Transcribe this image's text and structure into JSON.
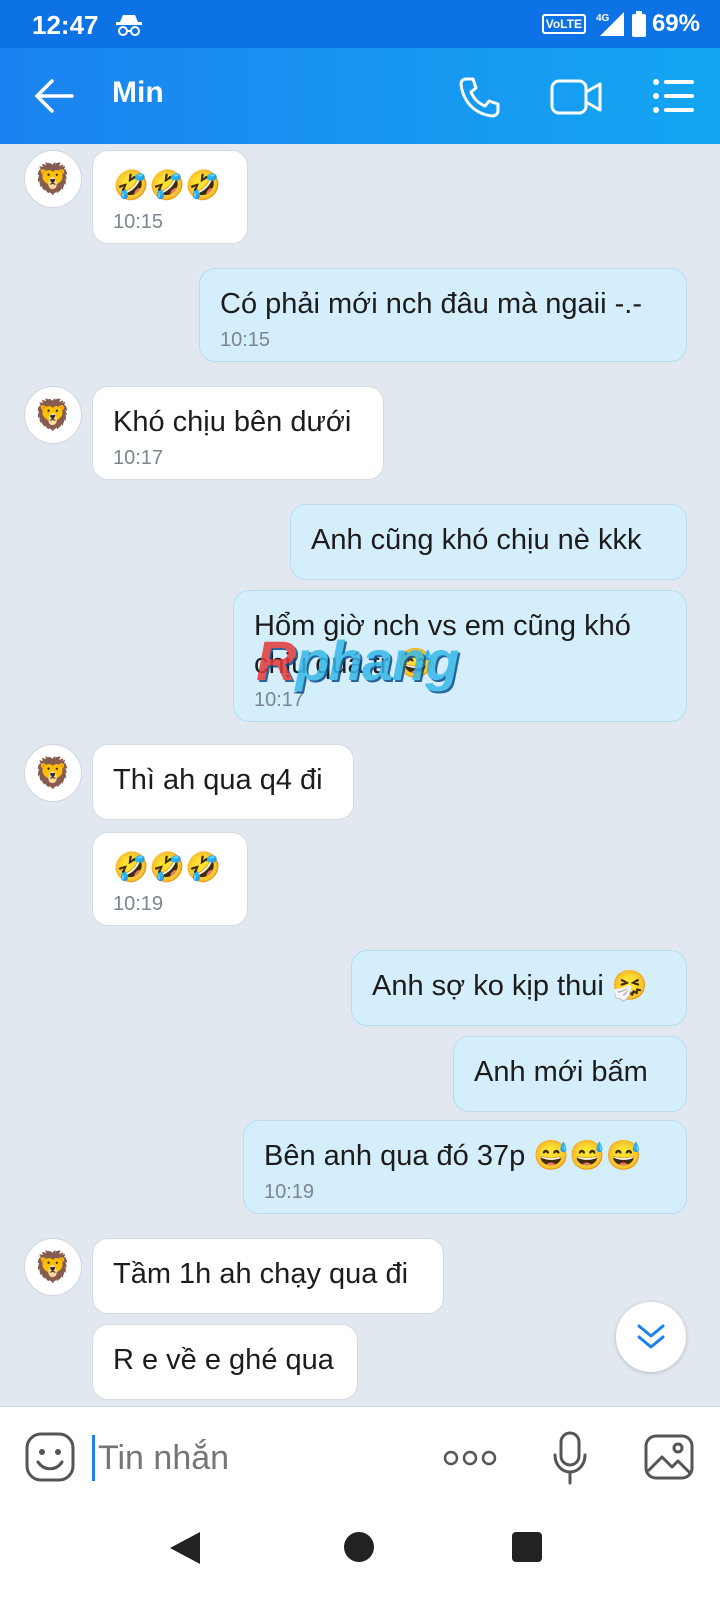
{
  "status": {
    "time": "12:47",
    "volte": "VoLTE",
    "network": "4G",
    "battery": "69%"
  },
  "header": {
    "title": "Min"
  },
  "messages": [
    {
      "text": "🤣🤣🤣",
      "time": "10:15"
    },
    {
      "text": "Có phải mới nch đâu mà ngaii -.-",
      "time": "10:15"
    },
    {
      "text": "Khó chịu bên dưới",
      "time": "10:17"
    },
    {
      "text": "Anh cũng khó chịu nè kkk",
      "time": ""
    },
    {
      "text": "Hổm giờ nch vs em cũng khó chịu quá tr 😅",
      "time": "10:17"
    },
    {
      "text": "Thì ah qua q4 đi",
      "time": ""
    },
    {
      "text": "🤣🤣🤣",
      "time": "10:19"
    },
    {
      "text": "Anh sợ ko kịp thui 🤧",
      "time": ""
    },
    {
      "text": "Anh mới bấm",
      "time": ""
    },
    {
      "text": "Bên anh qua đó 37p 😅😅😅",
      "time": "10:19"
    },
    {
      "text": "Tầm 1h ah chạy qua đi",
      "time": ""
    },
    {
      "text": "R e về e ghé qua",
      "time": ""
    }
  ],
  "avatar_glyph": "🦁",
  "watermark": {
    "part1": "R",
    "part2": "phang"
  },
  "input": {
    "placeholder": "Tin nhắn"
  }
}
